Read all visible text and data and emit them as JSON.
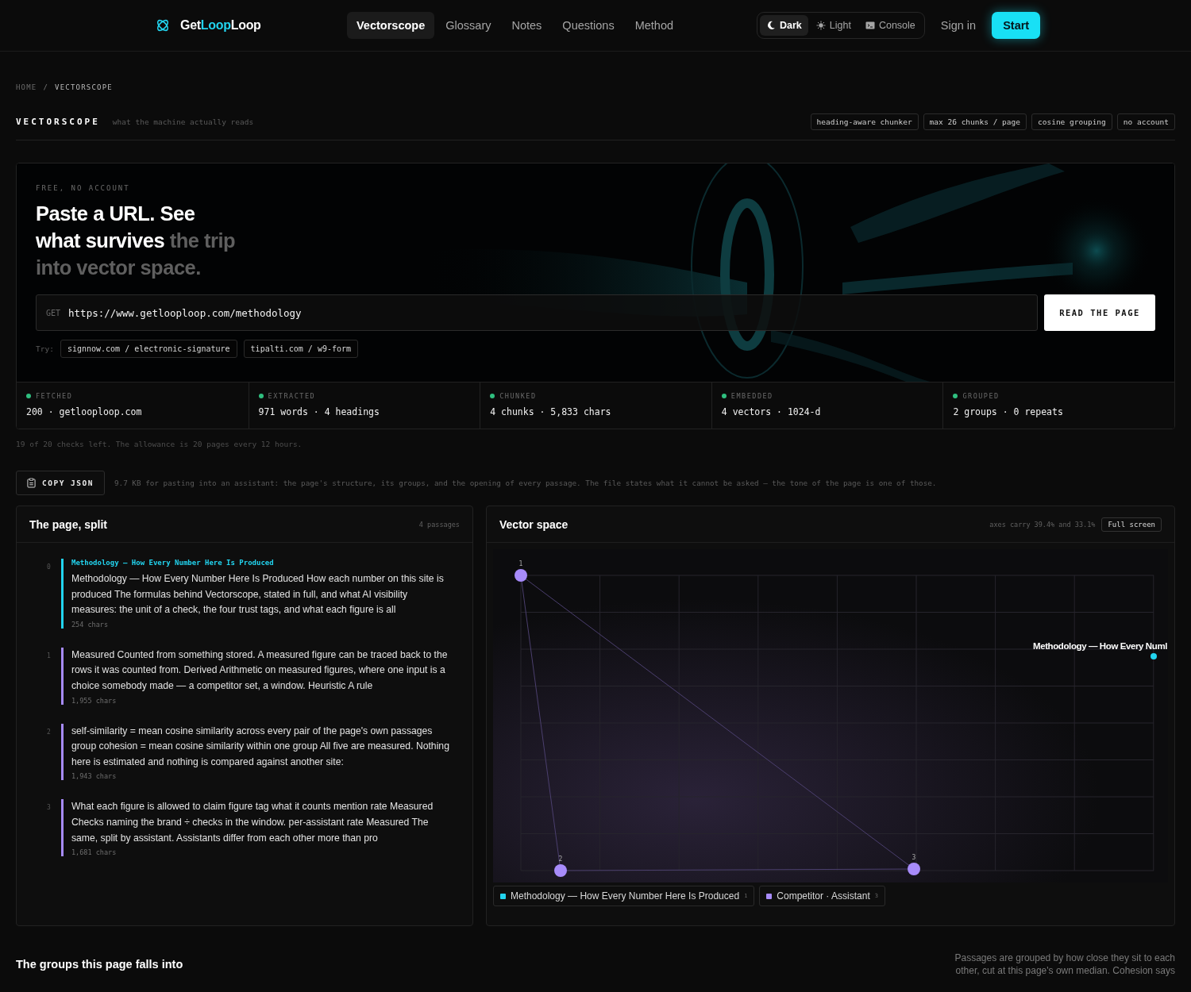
{
  "brand": {
    "name_start": "Get",
    "name_mid": "Loop",
    "name_end": "Loop"
  },
  "nav": [
    {
      "label": "Vectorscope",
      "selected": true
    },
    {
      "label": "Glossary",
      "selected": false
    },
    {
      "label": "Notes",
      "selected": false
    },
    {
      "label": "Questions",
      "selected": false
    },
    {
      "label": "Method",
      "selected": false
    }
  ],
  "theme": [
    {
      "label": "Dark",
      "kind": "moon",
      "selected": true
    },
    {
      "label": "Light",
      "kind": "sun",
      "selected": false
    },
    {
      "label": "Console",
      "kind": "terminal",
      "selected": false
    }
  ],
  "sign_in": "Sign in",
  "start": "Start",
  "breadcrumb": [
    "HOME",
    "VECTORSCOPE"
  ],
  "breadcrumb_sep": "/",
  "title": "VECTORSCOPE",
  "subtitle": "what the machine actually reads",
  "tags": [
    "heading-aware chunker",
    "max 26 chunks / page",
    "cosine grouping",
    "no account"
  ],
  "hero": {
    "eyebrow": "FREE, NO ACCOUNT",
    "headline_bright": "Paste a URL. See what survives",
    "headline_dim": "the trip into vector space.",
    "method": "GET",
    "url": "https://www.getlooploop.com/methodology",
    "button": "READ THE PAGE",
    "try_label": "Try:",
    "examples": [
      "signnow.com / electronic-signature",
      "tipalti.com / w9-form"
    ]
  },
  "steps": [
    {
      "label": "FETCHED",
      "value": "200 · getlooploop.com",
      "done": true
    },
    {
      "label": "EXTRACTED",
      "value": "971 words · 4 headings",
      "done": true
    },
    {
      "label": "CHUNKED",
      "value": "4 chunks · 5,833 chars",
      "done": true
    },
    {
      "label": "EMBEDDED",
      "value": "4 vectors · 1024-d",
      "done": true
    },
    {
      "label": "GROUPED",
      "value": "2 groups · 0 repeats",
      "done": true
    }
  ],
  "allowance": "19 of 20 checks left. The allowance is 20 pages every 12 hours.",
  "copy_json": "COPY JSON",
  "copy_note": "9.7 KB for pasting into an assistant: the page's structure, its groups, and the opening of every passage. The file states what it cannot be asked — the tone of the page is one of those.",
  "split": {
    "title": "The page, split",
    "count": "4 passages",
    "passages": [
      {
        "index": "0",
        "color": "#22d3ee",
        "heading": "Methodology — How Every Number Here Is Produced",
        "text": "Methodology — How Every Number Here Is Produced How each number on this site is produced The formulas behind Vectorscope, stated in full, and what AI visibility measures: the unit of a check, the four trust tags, and what each figure is all",
        "chars": "254 chars"
      },
      {
        "index": "1",
        "color": "#a78bfa",
        "text": "Measured Counted from something stored. A measured figure can be traced back to the rows it was counted from. Derived Arithmetic on measured figures, where one input is a choice somebody made — a competitor set, a window. Heuristic A rule",
        "chars": "1,955 chars"
      },
      {
        "index": "2",
        "color": "#a78bfa",
        "text": "self-similarity = mean cosine similarity across every pair of the page's own passages group cohesion = mean cosine similarity within one group All five are measured. Nothing here is estimated and nothing is compared against another site:",
        "chars": "1,943 chars"
      },
      {
        "index": "3",
        "color": "#a78bfa",
        "text": "What each figure is allowed to claim figure tag what it counts mention rate Measured Checks naming the brand ÷ checks in the window. per-assistant rate Measured The same, split by assistant. Assistants differ from each other more than pro",
        "chars": "1,681 chars"
      }
    ]
  },
  "vector": {
    "title": "Vector space",
    "axes_note": "axes carry 39.4% and 33.1%",
    "full_screen": "Full screen",
    "points": [
      {
        "label": "1",
        "color": "#a78bfa"
      },
      {
        "label": "2",
        "color": "#a78bfa"
      },
      {
        "label": "3",
        "color": "#a78bfa"
      },
      {
        "label": "Methodology — How Every Numl",
        "color": "#22d3ee"
      }
    ],
    "legend": [
      {
        "name": "Methodology — How Every Number Here Is Produced",
        "count": "1",
        "color": "#22d3ee"
      },
      {
        "name": "Competitor · Assistant",
        "count": "3",
        "color": "#a78bfa"
      }
    ]
  },
  "groups": {
    "title": "The groups this page falls into",
    "note": "Passages are grouped by how close they sit to each other, cut at this page's own median. Cohesion says"
  }
}
